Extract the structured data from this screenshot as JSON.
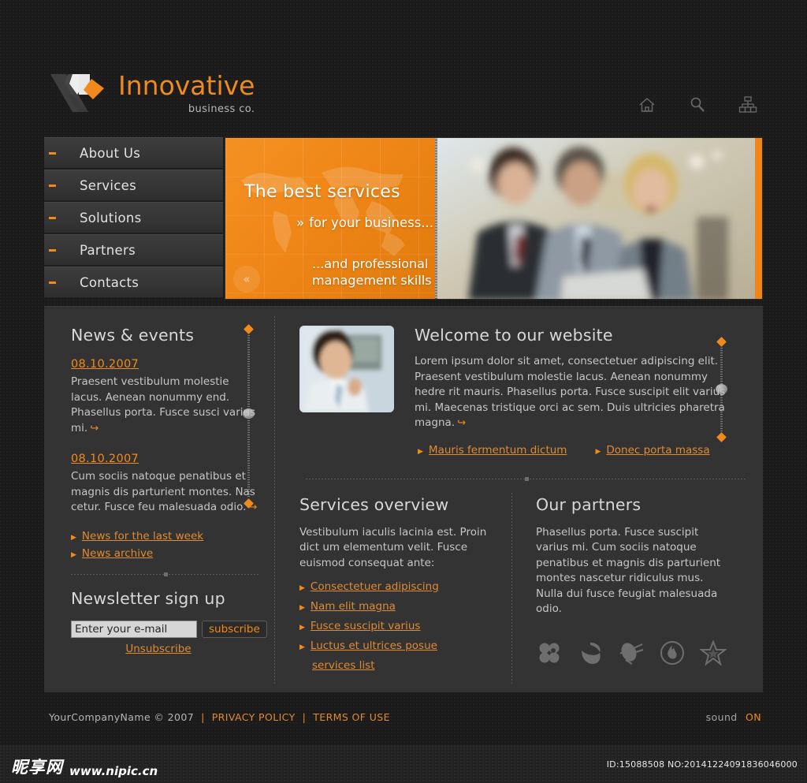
{
  "brand": {
    "title": "Innovative",
    "subtitle": "business co.",
    "logo_icon": "chevron-logo-icon"
  },
  "header_icons": [
    {
      "name": "home-icon",
      "label": "Home"
    },
    {
      "name": "search-icon",
      "label": "Search"
    },
    {
      "name": "sitemap-icon",
      "label": "Sitemap"
    }
  ],
  "nav": {
    "items": [
      {
        "label": "About Us"
      },
      {
        "label": "Services"
      },
      {
        "label": "Solutions"
      },
      {
        "label": "Partners"
      },
      {
        "label": "Contacts"
      }
    ]
  },
  "banner": {
    "line1": "The best services",
    "arrows": "»",
    "line2": "for your business...",
    "line3a": "...and professional",
    "line3b": "management skills",
    "rewind_label": "«",
    "accent_color": "#ef8617"
  },
  "news": {
    "title": "News & events",
    "items": [
      {
        "date": "08.10.2007",
        "body": "Praesent vestibulum molestie lacus. Aenean nonummy end. Phasellus porta. Fusce susci varius mi."
      },
      {
        "date": "08.10.2007",
        "body": "Cum sociis natoque penatibus et magnis dis parturient montes. Nas cetur. Fusce feu malesuada odio."
      }
    ],
    "links": [
      {
        "label": "News for the last week"
      },
      {
        "label": "News archive"
      }
    ]
  },
  "newsletter": {
    "title": "Newsletter sign up",
    "input_value": "Enter your e-mail",
    "input_placeholder": "Enter your e-mail",
    "button_label": "subscribe",
    "unsubscribe_label": "Unsubscribe"
  },
  "welcome": {
    "title": "Welcome to our website",
    "body": "Lorem ipsum dolor sit amet, consectetuer adipiscing elit. Praesent vestibulum molestie lacus. Aenean nonummy hedre rit mauris. Phasellus porta. Fusce suscipit elit varius mi. Maecenas tristique orci ac sem. Duis ultricies pharetra magna.",
    "links": [
      {
        "label": "Mauris fermentum dictum"
      },
      {
        "label": "Donec porta massa"
      }
    ],
    "photo_alt": "businessman-photo"
  },
  "services": {
    "title": "Services overview",
    "body": "Vestibulum iaculis lacinia est. Proin dict um elementum velit. Fusce euismod consequat ante:",
    "links": [
      {
        "label": "Consectetuer adipiscing"
      },
      {
        "label": "Nam elit magna"
      },
      {
        "label": "Fusce suscipit varius"
      },
      {
        "label": "Luctus et ultrices posue"
      }
    ],
    "plain_link": "services list"
  },
  "partners": {
    "title": "Our partners",
    "body": "Phasellus porta. Fusce suscipit varius mi. Cum sociis natoque penatibus et magnis dis parturient montes nascetur ridiculus mus. Nulla dui fusce feugiat malesuada odio.",
    "logos": [
      {
        "name": "clover-icon"
      },
      {
        "name": "acorn-icon"
      },
      {
        "name": "satellite-dish-icon"
      },
      {
        "name": "flame-circle-icon"
      },
      {
        "name": "star-icon"
      }
    ]
  },
  "footer": {
    "copyright": "YourCompanyName © 2007",
    "sep1": "|",
    "privacy": "PRIVACY POLICY",
    "sep2": "|",
    "terms": "TERMS OF USE",
    "sound_label": "sound",
    "sound_state": "ON"
  },
  "watermark": {
    "cn_text": "昵享网",
    "url": "www.nipic.cn",
    "id_text": "ID:15088508 NO:20141224091836046000"
  }
}
